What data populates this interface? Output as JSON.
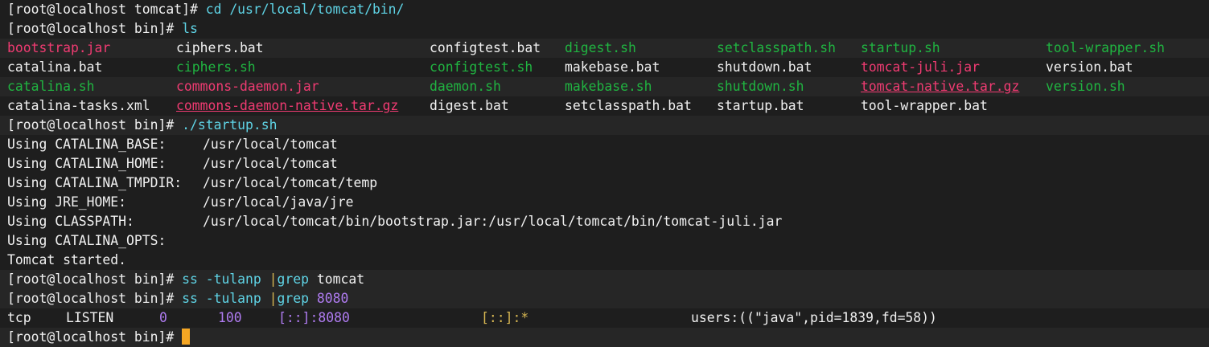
{
  "prompt": "[root@localhost bin]#",
  "line1": {
    "prompt": "[root@localhost tomcat]#",
    "cmd": "cd",
    "arg": "/usr/local/tomcat/bin/"
  },
  "line2": {
    "cmd": "ls"
  },
  "ls": [
    [
      {
        "t": "bootstrap.jar",
        "c": "red"
      },
      {
        "t": "ciphers.bat",
        "c": "text"
      },
      {
        "t": "configtest.bat",
        "c": "text"
      },
      {
        "t": "digest.sh",
        "c": "green"
      },
      {
        "t": "setclasspath.sh",
        "c": "green"
      },
      {
        "t": "startup.sh",
        "c": "green"
      },
      {
        "t": "tool-wrapper.sh",
        "c": "green"
      }
    ],
    [
      {
        "t": "catalina.bat",
        "c": "text"
      },
      {
        "t": "ciphers.sh",
        "c": "green"
      },
      {
        "t": "configtest.sh",
        "c": "green"
      },
      {
        "t": "makebase.bat",
        "c": "text"
      },
      {
        "t": "shutdown.bat",
        "c": "text"
      },
      {
        "t": "tomcat-juli.jar",
        "c": "red"
      },
      {
        "t": "version.bat",
        "c": "text"
      }
    ],
    [
      {
        "t": "catalina.sh",
        "c": "green"
      },
      {
        "t": "commons-daemon.jar",
        "c": "red"
      },
      {
        "t": "daemon.sh",
        "c": "green"
      },
      {
        "t": "makebase.sh",
        "c": "green"
      },
      {
        "t": "shutdown.sh",
        "c": "green"
      },
      {
        "t": "tomcat-native.tar.gz",
        "c": "red",
        "u": true
      },
      {
        "t": "version.sh",
        "c": "green"
      }
    ],
    [
      {
        "t": "catalina-tasks.xml",
        "c": "text"
      },
      {
        "t": "commons-daemon-native.tar.gz",
        "c": "red",
        "u": true
      },
      {
        "t": "digest.bat",
        "c": "text"
      },
      {
        "t": "setclasspath.bat",
        "c": "text"
      },
      {
        "t": "startup.bat",
        "c": "text"
      },
      {
        "t": "tool-wrapper.bat",
        "c": "text"
      },
      {
        "t": "",
        "c": "text"
      }
    ]
  ],
  "startup_cmd": "./startup.sh",
  "env": [
    {
      "k": "Using CATALINA_BASE:",
      "v": "/usr/local/tomcat"
    },
    {
      "k": "Using CATALINA_HOME:",
      "v": "/usr/local/tomcat"
    },
    {
      "k": "Using CATALINA_TMPDIR:",
      "v": "/usr/local/tomcat/temp"
    },
    {
      "k": "Using JRE_HOME:",
      "v": "/usr/local/java/jre"
    },
    {
      "k": "Using CLASSPATH:",
      "v": "/usr/local/tomcat/bin/bootstrap.jar:/usr/local/tomcat/bin/tomcat-juli.jar"
    },
    {
      "k": "Using CATALINA_OPTS:",
      "v": ""
    }
  ],
  "started": "Tomcat started.",
  "ss1": {
    "cmd": "ss -tulanp",
    "pipe": "|",
    "grep": "grep",
    "arg": "tomcat"
  },
  "ss2": {
    "cmd": "ss -tulanp",
    "pipe": "|",
    "grep": "grep",
    "arg": "8080"
  },
  "ssrow": {
    "proto": "tcp",
    "state": "LISTEN",
    "recvq": "0",
    "sendq": "100",
    "local": "[::]:8080",
    "peer": "[::]:*",
    "proc": "users:((\"java\",pid=1839,fd=58))"
  },
  "colors": {
    "bg": "#1e1e1e",
    "text": "#f1f1f1",
    "red": "#f03b72",
    "green": "#20b541",
    "cursor": "#f5a623"
  }
}
